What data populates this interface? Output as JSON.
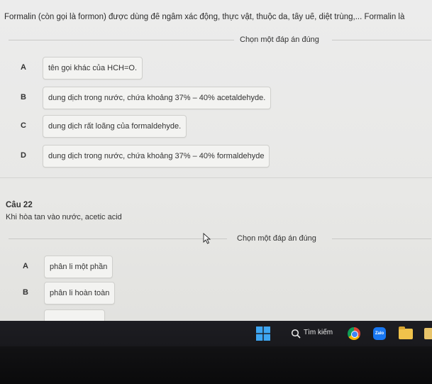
{
  "question_prev": {
    "text": "Formalin (còn gọi là formon) được dùng để ngâm xác động, thực vật, thuộc da, tẩy uế, diệt trùng,... Formalin là",
    "prompt": "Chọn một đáp án đúng",
    "options": [
      {
        "letter": "A",
        "text": "tên gọi khác của HCH=O."
      },
      {
        "letter": "B",
        "text": "dung dịch trong nước, chứa khoảng 37% – 40% acetaldehyde."
      },
      {
        "letter": "C",
        "text": "dung dịch rất loãng của formaldehyde."
      },
      {
        "letter": "D",
        "text": "dung dịch trong nước, chứa khoảng 37% – 40% formaldehyde"
      }
    ]
  },
  "question_22": {
    "heading": "Câu 22",
    "text": "Khi hòa tan vào nước, acetic acid",
    "prompt": "Chọn một đáp án đúng",
    "options": [
      {
        "letter": "A",
        "text": "phân li một phần"
      },
      {
        "letter": "B",
        "text": "phân li hoàn toàn"
      }
    ]
  },
  "taskbar": {
    "search_label": "Tìm kiếm",
    "zalo_label": "Zalo"
  },
  "colors": {
    "page_bg": "#ececec",
    "option_bg": "#f3f3f1",
    "taskbar_bg": "#1d1d22"
  }
}
